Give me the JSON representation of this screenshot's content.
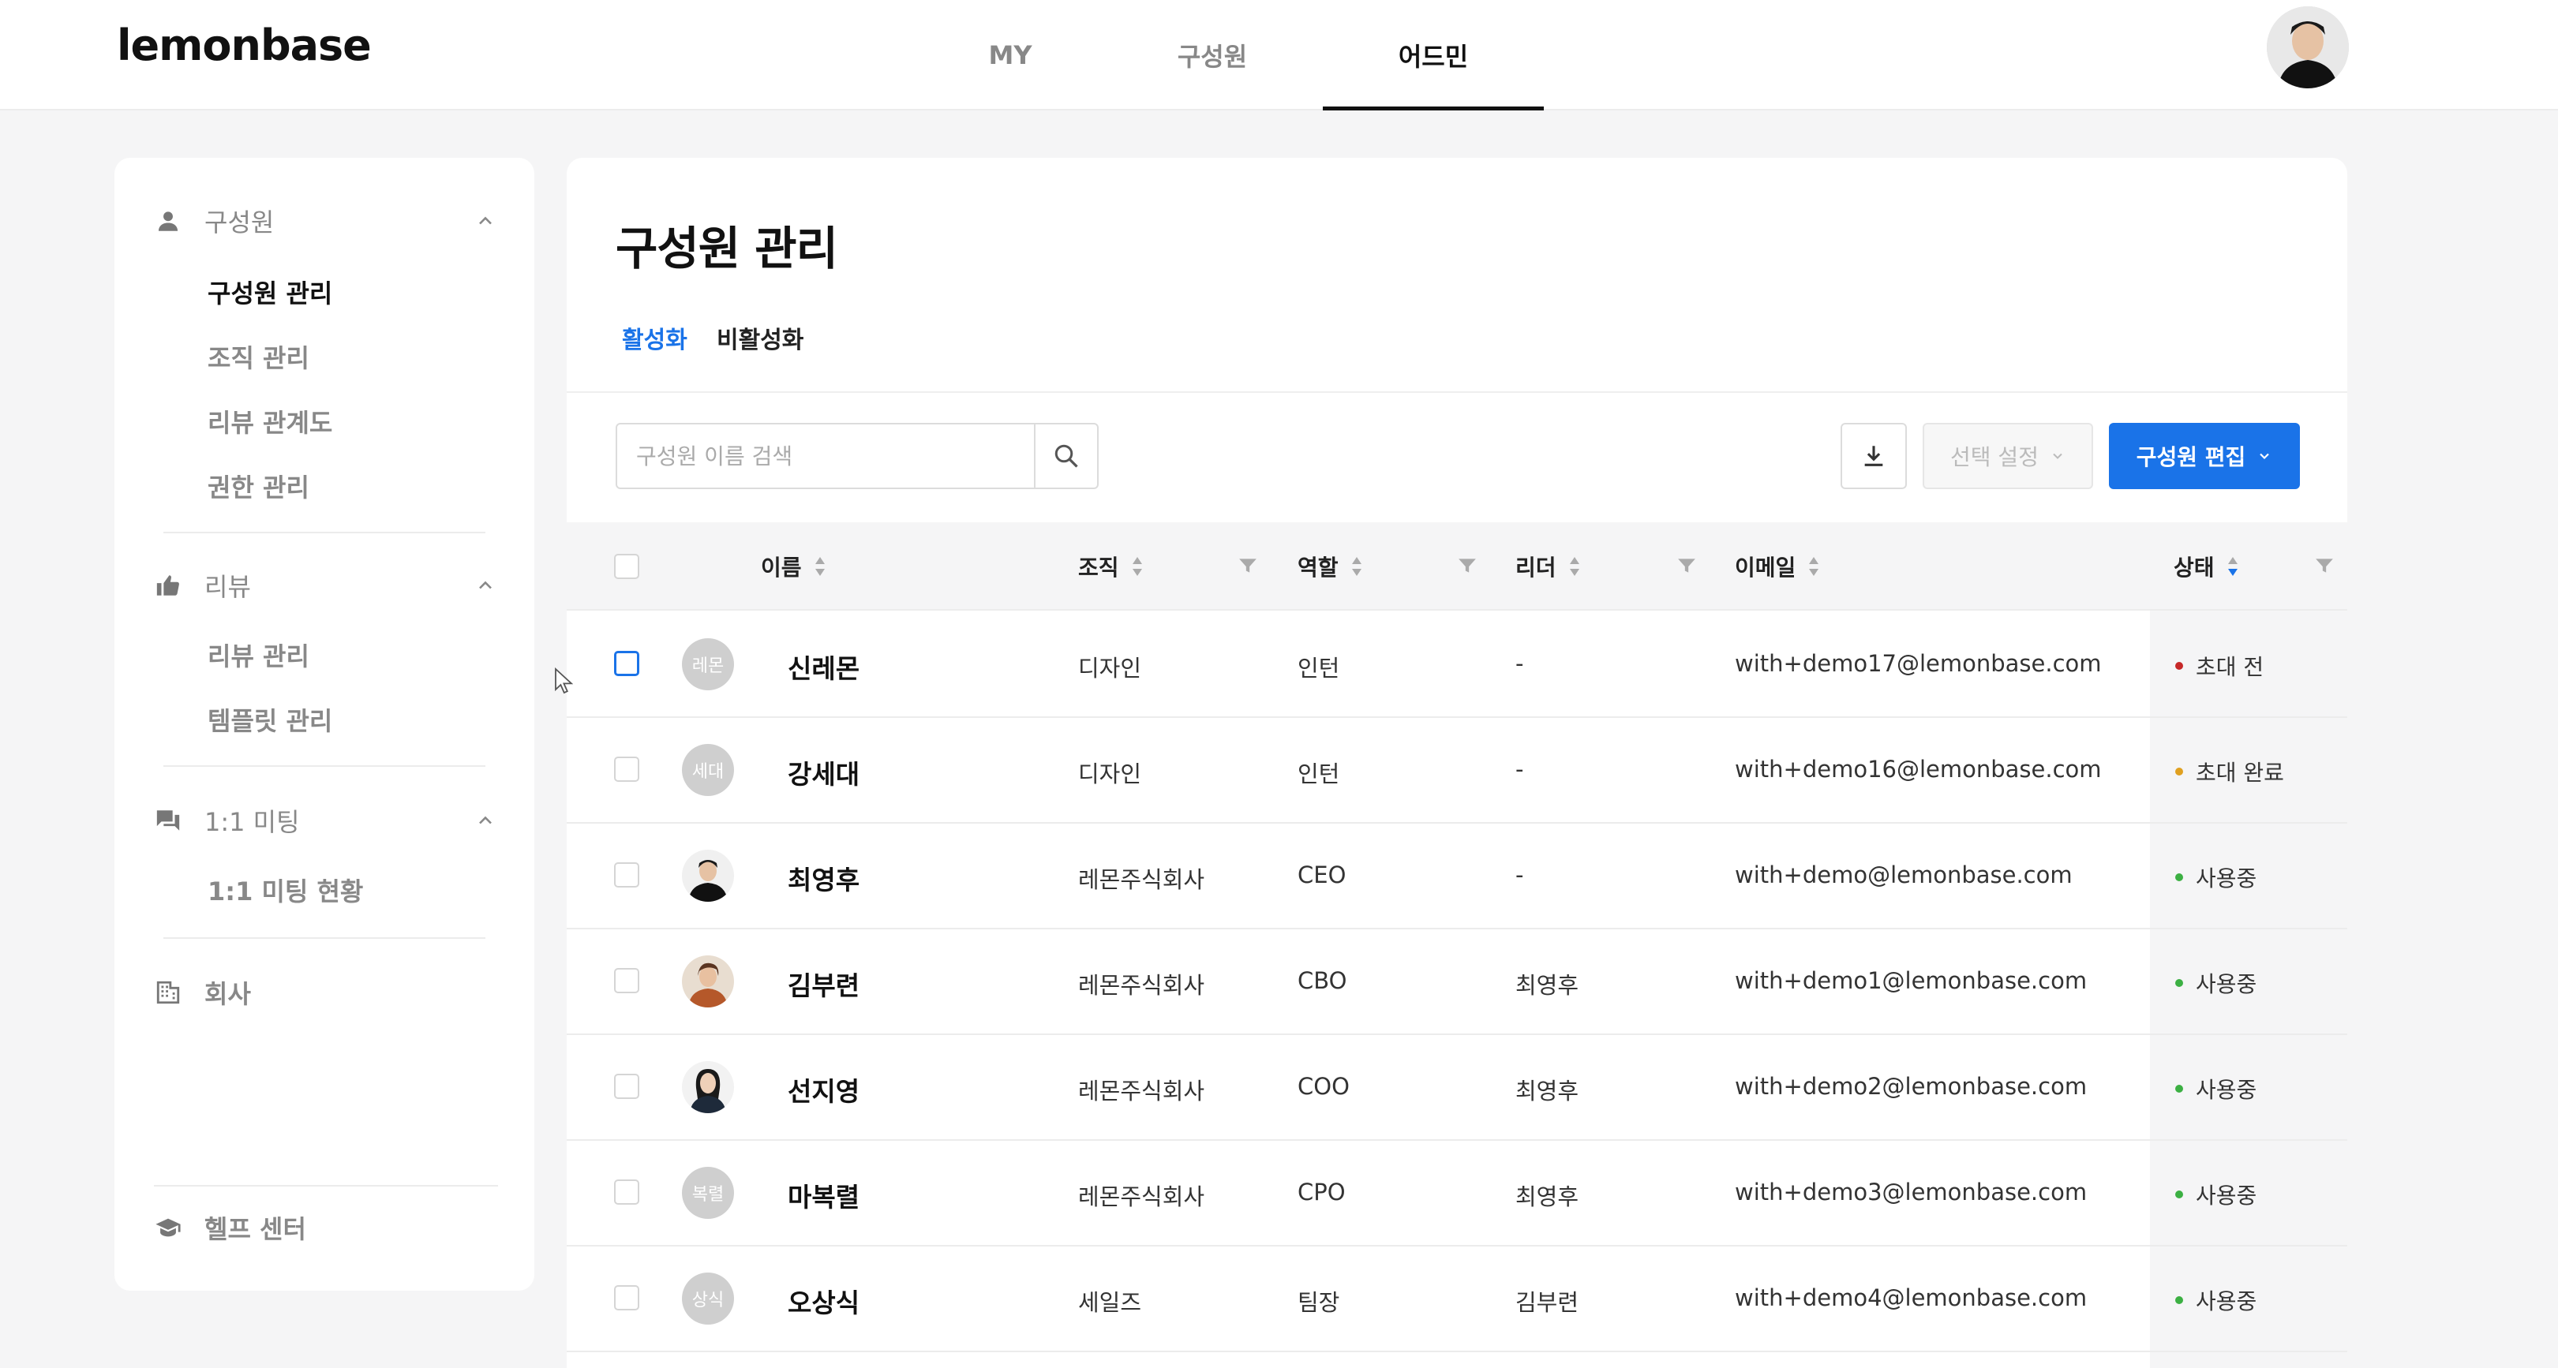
{
  "header": {
    "logo": "lemonbase",
    "nav": [
      {
        "label": "MY",
        "active": false
      },
      {
        "label": "구성원",
        "active": false
      },
      {
        "label": "어드민",
        "active": true
      }
    ]
  },
  "sidebar": {
    "sections": [
      {
        "label": "구성원",
        "icon": "person-icon",
        "items": [
          "구성원 관리",
          "조직 관리",
          "리뷰 관계도",
          "권한 관리"
        ],
        "active_item": "구성원 관리"
      },
      {
        "label": "리뷰",
        "icon": "thumbs-up-icon",
        "items": [
          "리뷰 관리",
          "템플릿 관리"
        ]
      },
      {
        "label": "1:1 미팅",
        "icon": "chat-icon",
        "items": [
          "1:1 미팅 현황"
        ]
      }
    ],
    "company": "회사",
    "help": "헬프 센터"
  },
  "main": {
    "title": "구성원 관리",
    "tabs": [
      {
        "label": "활성화",
        "active": true
      },
      {
        "label": "비활성화",
        "active": false
      }
    ],
    "search": {
      "placeholder": "구성원 이름 검색",
      "value": ""
    },
    "select_settings": "선택 설정",
    "edit_members": "구성원 편집",
    "columns": {
      "name": "이름",
      "org": "조직",
      "role": "역할",
      "leader": "리더",
      "email": "이메일",
      "status": "상태"
    },
    "rows": [
      {
        "initials": "레몬",
        "photo": false,
        "name": "신레몬",
        "org": "디자인",
        "role": "인턴",
        "leader": "-",
        "email": "with+demo17@lemonbase.com",
        "status": "초대 전",
        "status_color": "#c62828"
      },
      {
        "initials": "세대",
        "photo": false,
        "name": "강세대",
        "org": "디자인",
        "role": "인턴",
        "leader": "-",
        "email": "with+demo16@lemonbase.com",
        "status": "초대 완료",
        "status_color": "#e0a020"
      },
      {
        "initials": "",
        "photo": true,
        "name": "최영후",
        "org": "레몬주식회사",
        "role": "CEO",
        "leader": "-",
        "email": "with+demo@lemonbase.com",
        "status": "사용중",
        "status_color": "#3cb043"
      },
      {
        "initials": "",
        "photo": true,
        "name": "김부련",
        "org": "레몬주식회사",
        "role": "CBO",
        "leader": "최영후",
        "email": "with+demo1@lemonbase.com",
        "status": "사용중",
        "status_color": "#3cb043"
      },
      {
        "initials": "",
        "photo": true,
        "name": "선지영",
        "org": "레몬주식회사",
        "role": "COO",
        "leader": "최영후",
        "email": "with+demo2@lemonbase.com",
        "status": "사용중",
        "status_color": "#3cb043"
      },
      {
        "initials": "복렬",
        "photo": false,
        "name": "마복렬",
        "org": "레몬주식회사",
        "role": "CPO",
        "leader": "최영후",
        "email": "with+demo3@lemonbase.com",
        "status": "사용중",
        "status_color": "#3cb043"
      },
      {
        "initials": "상식",
        "photo": false,
        "name": "오상식",
        "org": "세일즈",
        "role": "팀장",
        "leader": "김부련",
        "email": "with+demo4@lemonbase.com",
        "status": "사용중",
        "status_color": "#3cb043"
      }
    ]
  },
  "colors": {
    "accent": "#1a73e8",
    "background": "#f5f5f6"
  }
}
